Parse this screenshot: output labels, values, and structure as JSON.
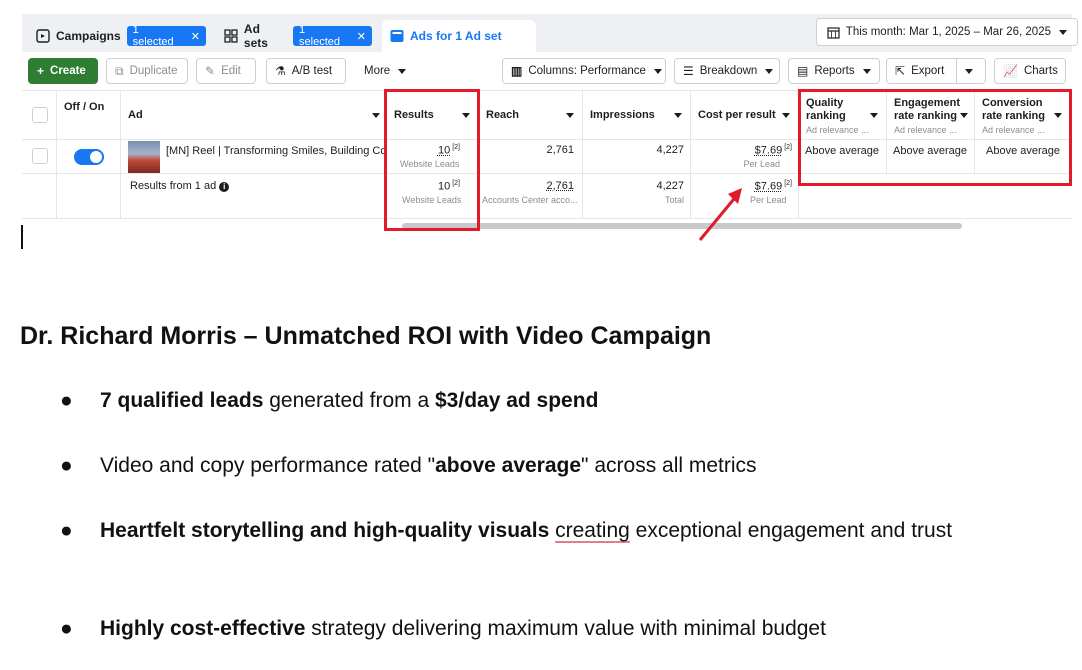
{
  "tabs": {
    "campaigns": {
      "label": "Campaigns",
      "badge": "1 selected",
      "close": "✕"
    },
    "adsets": {
      "label": "Ad sets",
      "badge": "1 selected",
      "close": "✕"
    },
    "ads": {
      "label": "Ads for 1 Ad set"
    }
  },
  "date_range": "This month: Mar 1, 2025 – Mar 26, 2025",
  "toolbar": {
    "create": "Create",
    "duplicate": "Duplicate",
    "edit": "Edit",
    "ab_test": "A/B test",
    "more": "More",
    "columns": "Columns: Performance",
    "breakdown": "Breakdown",
    "reports": "Reports",
    "export": "Export",
    "charts": "Charts"
  },
  "columns": {
    "off_on": "Off / On",
    "ad": "Ad",
    "results": "Results",
    "reach": "Reach",
    "impressions": "Impressions",
    "cost_per_result": "Cost per result",
    "quality_ranking": "Quality ranking",
    "engagement_ranking": "Engagement rate ranking",
    "conversion_ranking": "Conversion rate ranking",
    "relevance_sub": "Ad relevance ..."
  },
  "row": {
    "ad_name": "[MN] Reel | Transforming Smiles, Building Co...",
    "results": "10",
    "results_sup": "[2]",
    "results_sub": "Website Leads",
    "reach": "2,761",
    "impressions": "4,227",
    "cost": "$7.69",
    "cost_sup": "[2]",
    "cost_sub": "Per Lead",
    "quality": "Above average",
    "engagement": "Above average",
    "conversion": "Above average"
  },
  "summary": {
    "label": "Results from 1 ad",
    "results": "10",
    "results_sup": "[2]",
    "results_sub": "Website Leads",
    "reach": "2,761",
    "reach_sub": "Accounts Center acco...",
    "impressions": "4,227",
    "impressions_sub": "Total",
    "cost": "$7.69",
    "cost_sup": "[2]",
    "cost_sub": "Per Lead"
  },
  "doc": {
    "title": "Dr. Richard Morris – Unmatched ROI with Video Campaign",
    "b1_bold1": "7 qualified leads",
    "b1_mid": " generated from a ",
    "b1_bold2": "$3/day ad spend",
    "b2_pre": "Video and copy performance rated \"",
    "b2_bold": "above average",
    "b2_post": "\" across all metrics",
    "b3_bold": "Heartfelt storytelling and high-quality visuals",
    "b3_sq": "creating",
    "b3_post": " exceptional engagement and trust",
    "b4_bold": "Highly cost-effective",
    "b4_post": " strategy delivering maximum value with minimal budget"
  },
  "colors": {
    "accent": "#1877f2",
    "highlight": "#e21b2a",
    "create": "#2e7d32"
  }
}
